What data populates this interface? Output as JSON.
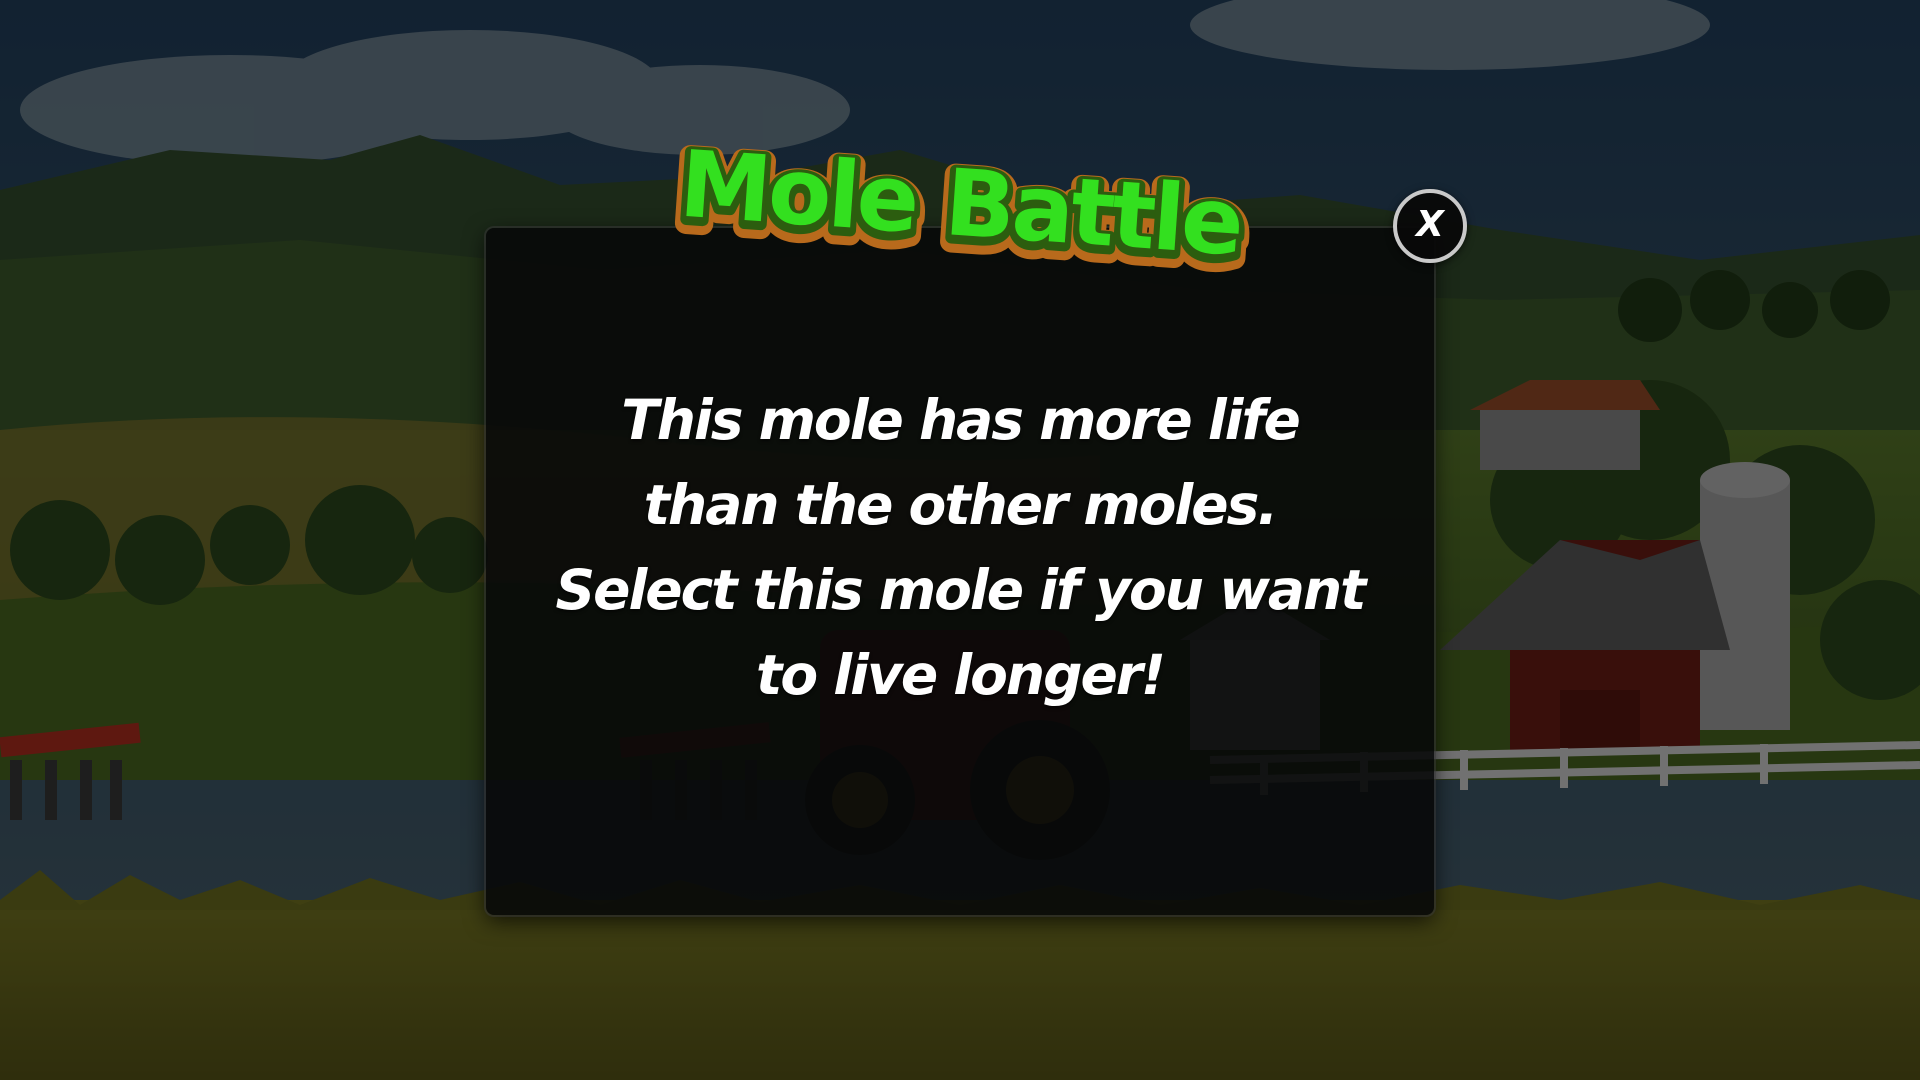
{
  "game": {
    "title": "Mole Battle",
    "close_label": "X"
  },
  "dialog": {
    "lines": [
      "This mole has more life",
      "than the other moles.",
      "Select this mole if you want",
      "to live longer!"
    ]
  },
  "colors": {
    "title_fill": "#33e01f",
    "title_outline": "#2c5d0f",
    "title_edge": "#b86a1c",
    "panel_bg": "#080909",
    "text": "#ffffff",
    "close_ring": "#c9c9c9"
  }
}
